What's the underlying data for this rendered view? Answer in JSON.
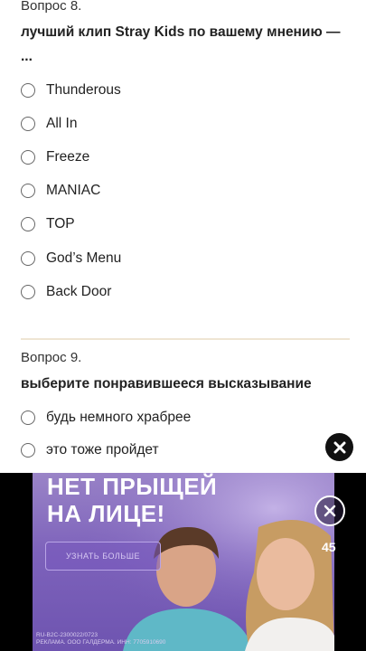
{
  "question8": {
    "number": "Вопрос 8.",
    "text": "лучший клип Stray Kids по вашему мнению — ...",
    "options": [
      "Thunderous",
      "All In",
      "Freeze",
      "MANIAC",
      "TOP",
      "God’s Menu",
      "Back Door"
    ]
  },
  "question9": {
    "number": "Вопрос 9.",
    "text": "выберите понравившееся высказывание",
    "options": [
      "будь немного храбрее",
      "это тоже пройдет"
    ]
  },
  "close_icon": "close-icon",
  "ad": {
    "headline_line1": "НЕТ ПРЫЩЕЙ",
    "headline_line2": "НА ЛИЦЕ!",
    "button": "УЗНАТЬ БОЛЬШЕ",
    "timer": "45",
    "legal_line1": "RU-B2C-2300022/0723",
    "legal_line2": "РЕКЛАМА. ООО ГАЛДЕРМА. ИНН: 7705910690",
    "colors": {
      "background": "#7d62bb",
      "text": "#ffffff"
    }
  }
}
